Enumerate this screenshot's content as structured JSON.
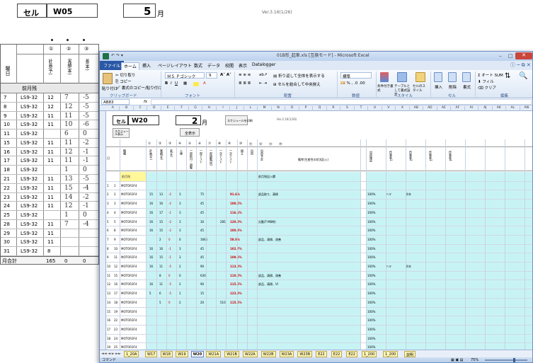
{
  "background": {
    "cell_label": "セル",
    "cell_value": "W05",
    "month_num": "5",
    "month_unit": "月",
    "version": "Ver.3.16(1/26)",
    "circle_headers": [
      "①",
      "②",
      "③"
    ],
    "col_headers": [
      "曜日",
      "計画(予)",
      "実績(本)",
      "差(本)"
    ],
    "carry_label": "前月残",
    "rows": [
      {
        "d": "7",
        "m": "LS9-32",
        "plan": "12",
        "act": "7",
        "diff": "-5"
      },
      {
        "d": "8",
        "m": "LS9-32",
        "plan": "12",
        "act": "12",
        "diff": "-5"
      },
      {
        "d": "9",
        "m": "LS9-32",
        "plan": "11",
        "act": "11",
        "diff": "-5"
      },
      {
        "d": "10",
        "m": "LS9-32",
        "plan": "11",
        "act": "10",
        "diff": "-6"
      },
      {
        "d": "11",
        "m": "LS9-32",
        "plan": "",
        "act": "6",
        "diff": "0"
      },
      {
        "d": "15",
        "m": "LS9-32",
        "plan": "11",
        "act": "11",
        "diff": "-2"
      },
      {
        "d": "16",
        "m": "LS9-32",
        "plan": "11",
        "act": "12",
        "diff": "-1"
      },
      {
        "d": "17",
        "m": "LS9-32",
        "plan": "11",
        "act": "11",
        "diff": "-1"
      },
      {
        "d": "18",
        "m": "LS9-32",
        "plan": "",
        "act": "1",
        "diff": "0"
      },
      {
        "d": "21",
        "m": "LS9-32",
        "plan": "11",
        "act": "13",
        "diff": "-5"
      },
      {
        "d": "22",
        "m": "LS9-32",
        "plan": "11",
        "act": "15",
        "diff": "-4"
      },
      {
        "d": "23",
        "m": "LS9-32",
        "plan": "11",
        "act": "14",
        "diff": "-2"
      },
      {
        "d": "24",
        "m": "LS9-32",
        "plan": "11",
        "act": "12",
        "diff": "-1"
      },
      {
        "d": "25",
        "m": "LS9-32",
        "plan": "",
        "act": "1",
        "diff": "0"
      },
      {
        "d": "28",
        "m": "LS9-32",
        "plan": "11",
        "act": "7",
        "diff": "-4"
      },
      {
        "d": "29",
        "m": "LS9-32",
        "plan": "11",
        "act": "",
        "diff": ""
      },
      {
        "d": "30",
        "m": "LS9-32",
        "plan": "11",
        "act": "",
        "diff": ""
      },
      {
        "d": "31",
        "m": "LS9-32",
        "plan": "8",
        "act": "",
        "diff": ""
      }
    ],
    "total_label": "月合計",
    "total_plan": "165",
    "total_act": "0",
    "total_diff": "0"
  },
  "excel": {
    "title": "01B形_起車.xls [互換モード] - Microsoft Excel",
    "ribbon_tabs": [
      "ファイル",
      "ホーム",
      "挿入",
      "ページレイアウト",
      "数式",
      "データ",
      "校閲",
      "表示",
      "Datalogger"
    ],
    "clipboard": {
      "cut": "切り取り",
      "copy": "コピー",
      "format": "書式のコピー/貼り付け",
      "paste": "貼り付け",
      "group": "クリップボード"
    },
    "font": {
      "name": "ＭＳ Ｐゴシック",
      "size": "9",
      "group": "フォント"
    },
    "alignment": {
      "wrap": "折り返して全体を表示する",
      "merge": "セルを結合して中央揃え",
      "group": "配置"
    },
    "number": {
      "format": "標準",
      "group": "数値"
    },
    "styles": {
      "cond": "条件付き書式",
      "table": "テーブルとして書式設定",
      "cell": "セルのスタイル",
      "group": "スタイル"
    },
    "cells": {
      "insert": "挿入",
      "delete": "削除",
      "format": "書式",
      "group": "セル"
    },
    "editing": {
      "autosum": "オート SUM",
      "fill": "フィル",
      "clear": "クリア",
      "sort": "並べ替えとフィルター",
      "find": "検索と選択",
      "group": "編集"
    },
    "name_box": "AB83",
    "fx": "fx",
    "col_letters": [
      "A",
      "B",
      "C",
      "D",
      "E",
      "F",
      "G",
      "H",
      "I",
      "J",
      "L",
      "M",
      "N",
      "O",
      "P",
      "Q",
      "R",
      "S",
      "T",
      "U",
      "V",
      "X",
      "AB",
      "AD",
      "AE",
      "AF",
      "AI",
      "AJ",
      "AK",
      "AL",
      "AN"
    ],
    "sheet": {
      "cell_label": "セル",
      "cell_value": "W20",
      "month_num": "2",
      "month_unit": "月",
      "version": "Ver.2.16(1/26)",
      "btn1": "スケジュール表示",
      "btn2": "全表示",
      "btn3": "スケジュールを印刷",
      "circle_headers": [
        "①",
        "②",
        "③",
        "④",
        "⑤",
        "⑥",
        "⑦",
        "⑧",
        "⑨",
        "⑩",
        "⑪",
        "⑫",
        "⑬",
        "⑭"
      ],
      "headers": [
        "機種",
        "計画(予)",
        "実績(本)",
        "差(本)",
        "入庫",
        "一部取付・調整",
        "一部テスト",
        "一部調整(試)",
        "一次テスト",
        "一次テスト",
        "組立",
        "出荷",
        "出荷予定",
        "備考(生産性の状況記入)"
      ],
      "right_headers": [
        "出荷確認",
        "作業者1",
        "作業者2",
        "作業者3",
        "作業者4"
      ],
      "carry_label": "前月残",
      "notes_label": "前月残記入欄",
      "rows": [
        {
          "r": "1",
          "d": "1",
          "m": "MOTOR3F4",
          "p": "",
          "a": "",
          "df": "",
          "x1": "",
          "x2": "",
          "fin": "",
          "mark": "",
          "note": "",
          "c": "",
          "w1": "",
          "w2": ""
        },
        {
          "r": "2",
          "d": "2",
          "m": "MOTOR3F4",
          "p": "15",
          "a": "13",
          "df": "-2",
          "x1": "3",
          "x2": "75",
          "fin": "",
          "mark": "91.6%",
          "note": "部品取り、清掃",
          "c": "100%",
          "w1": "ハマ",
          "w2": "鈴木"
        },
        {
          "r": "3",
          "d": "3",
          "m": "MOTOR3F4",
          "p": "16",
          "a": "16",
          "df": "-2",
          "x1": "3",
          "x2": "45",
          "fin": "",
          "mark": "100.5%",
          "note": "",
          "c": "100%",
          "w1": "",
          "w2": ""
        },
        {
          "r": "4",
          "d": "4",
          "m": "MOTOR3F4",
          "p": "16",
          "a": "17",
          "df": "-1",
          "x1": "3",
          "x2": "45",
          "fin": "",
          "mark": "116.6%",
          "note": "",
          "c": "100%",
          "w1": "",
          "w2": ""
        },
        {
          "r": "5",
          "d": "5",
          "m": "MOTOR3F4",
          "p": "16",
          "a": "15",
          "df": "-2",
          "x1": "3",
          "x2": "30",
          "fin": "285",
          "mark": "120.0%",
          "note": "欠勤(T-M8時)",
          "c": "100%",
          "w1": "",
          "w2": ""
        },
        {
          "r": "6",
          "d": "8",
          "m": "MOTOR3F4",
          "p": "16",
          "a": "15",
          "df": "-2",
          "x1": "3",
          "x2": "45",
          "fin": "",
          "mark": "100.3%",
          "note": "",
          "c": "100%",
          "w1": "",
          "w2": ""
        },
        {
          "r": "7",
          "d": "9",
          "m": "MOTOR3F4",
          "p": "",
          "a": "2",
          "df": "0",
          "x1": "0",
          "x2": "1665",
          "fin": "",
          "mark": "58.0%",
          "note": "部品、清掃、改善",
          "c": "100%",
          "w1": "",
          "w2": ""
        },
        {
          "r": "8",
          "d": "10",
          "m": "MOTOR3F4",
          "p": "16",
          "a": "16",
          "df": "-1",
          "x1": "3",
          "x2": "45",
          "fin": "",
          "mark": "102.7%",
          "note": "",
          "c": "100%",
          "w1": "",
          "w2": ""
        },
        {
          "r": "9",
          "d": "11",
          "m": "MOTOR3F4",
          "p": "16",
          "a": "15",
          "df": "-1",
          "x1": "3",
          "x2": "45",
          "fin": "",
          "mark": "109.5%",
          "note": "",
          "c": "100%",
          "w1": "",
          "w2": ""
        },
        {
          "r": "10",
          "d": "12",
          "m": "MOTOR3F4",
          "p": "16",
          "a": "11",
          "df": "-5",
          "x1": "2",
          "x2": "90",
          "fin": "",
          "mark": "113.0%",
          "note": "",
          "c": "100%",
          "w1": "ハマ",
          "w2": "鈴木"
        },
        {
          "r": "11",
          "d": "15",
          "m": "MOTOR3F4",
          "p": "",
          "a": "8",
          "df": "0",
          "x1": "0",
          "x2": "630",
          "fin": "",
          "mark": "110.0%",
          "note": "部品、清掃、改善",
          "c": "100%",
          "w1": "",
          "w2": ""
        },
        {
          "r": "12",
          "d": "16",
          "m": "MOTOR3F4",
          "p": "16",
          "a": "11",
          "df": "-5",
          "x1": "2",
          "x2": "90",
          "fin": "",
          "mark": "115.5%",
          "note": "部品、清掃、VI",
          "c": "100%",
          "w1": "",
          "w2": ""
        },
        {
          "r": "13",
          "d": "17",
          "m": "MOTOR3F4",
          "p": "5",
          "a": "6",
          "df": "-5",
          "x1": "1",
          "x2": "15",
          "fin": "",
          "mark": "123.3%",
          "note": "",
          "c": "100%",
          "w1": "",
          "w2": ""
        },
        {
          "r": "14",
          "d": "18",
          "m": "MOTOR3F4",
          "p": "",
          "a": "5",
          "df": "0",
          "x1": "2",
          "x2": "20",
          "fin": "510",
          "mark": "115.5%",
          "note": "",
          "c": "100%",
          "w1": "",
          "w2": ""
        },
        {
          "r": "15",
          "d": "19",
          "m": "MOTOR3F4",
          "p": "",
          "a": "",
          "df": "",
          "x1": "",
          "x2": "",
          "fin": "",
          "mark": "",
          "note": "",
          "c": "100%",
          "w1": "",
          "w2": ""
        },
        {
          "r": "16",
          "d": "22",
          "m": "MOTOR3F4",
          "p": "",
          "a": "",
          "df": "",
          "x1": "",
          "x2": "",
          "fin": "",
          "mark": "",
          "note": "",
          "c": "100%",
          "w1": "",
          "w2": ""
        },
        {
          "r": "17",
          "d": "23",
          "m": "MOTOR3F4",
          "p": "",
          "a": "",
          "df": "",
          "x1": "",
          "x2": "",
          "fin": "",
          "mark": "",
          "note": "",
          "c": "100%",
          "w1": "",
          "w2": ""
        },
        {
          "r": "18",
          "d": "24",
          "m": "MOTOR3F4",
          "p": "",
          "a": "",
          "df": "",
          "x1": "",
          "x2": "",
          "fin": "",
          "mark": "",
          "note": "",
          "c": "100%",
          "w1": "",
          "w2": ""
        },
        {
          "r": "19",
          "d": "25",
          "m": "MOTOR3F4",
          "p": "",
          "a": "",
          "df": "",
          "x1": "",
          "x2": "",
          "fin": "",
          "mark": "",
          "note": "",
          "c": "100%",
          "w1": "",
          "w2": ""
        },
        {
          "r": "20",
          "d": "26",
          "m": "MOTOR3F4",
          "p": "",
          "a": "",
          "df": "",
          "x1": "",
          "x2": "",
          "fin": "",
          "mark": "",
          "note": "",
          "c": "100%",
          "w1": "",
          "w2": ""
        }
      ],
      "total_label": "月合計",
      "total_plan": "165",
      "total_act": "169",
      "total_diff": "0",
      "total_x1": "33",
      "total_x2": "1845",
      "total_fin": "795",
      "total_mark": "108.6%",
      "total_c": "100%"
    },
    "sheet_tabs": [
      "1_20A",
      "W17",
      "W18",
      "W19",
      "W20",
      "W21A",
      "W21B",
      "W22A",
      "W22B",
      "W23A",
      "W23B",
      "E22",
      "E22",
      "E22",
      "1_200",
      "1_200",
      "説明"
    ],
    "active_tab": "W20",
    "status_left": "コマンド",
    "zoom": "75%"
  }
}
